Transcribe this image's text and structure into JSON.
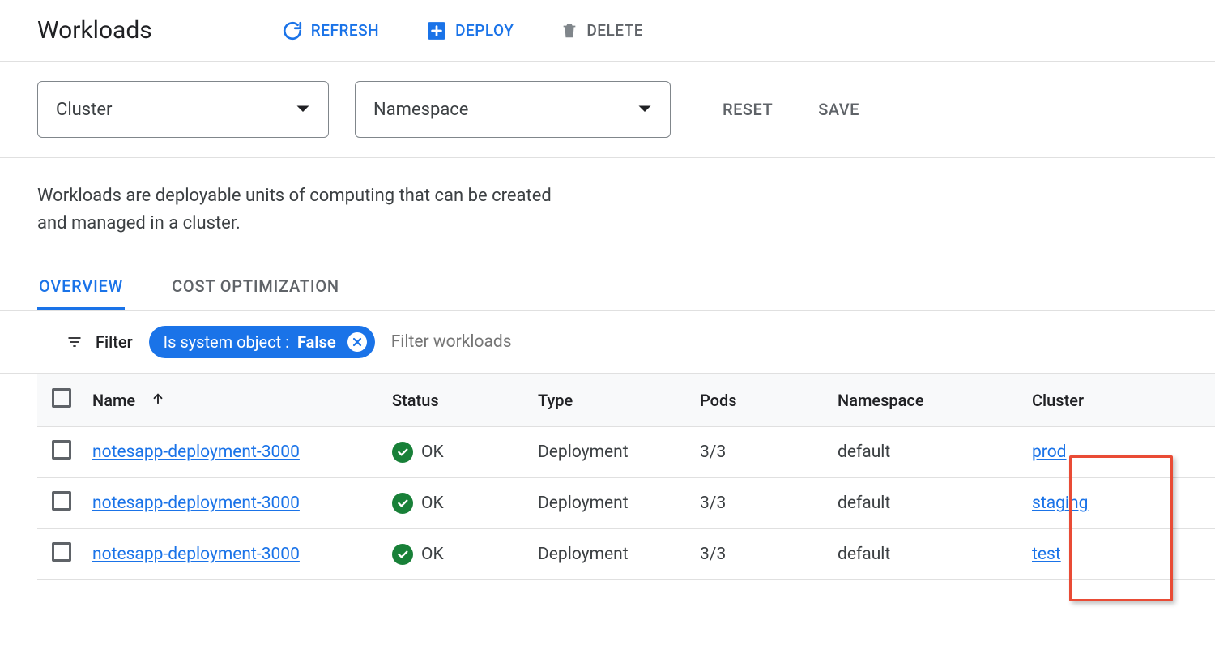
{
  "header": {
    "title": "Workloads",
    "actions": {
      "refresh": "REFRESH",
      "deploy": "DEPLOY",
      "delete": "DELETE"
    }
  },
  "filters": {
    "cluster_label": "Cluster",
    "namespace_label": "Namespace",
    "reset": "RESET",
    "save": "SAVE"
  },
  "description": "Workloads are deployable units of computing that can be created and managed in a cluster.",
  "tabs": {
    "overview": "OVERVIEW",
    "cost_optimization": "COST OPTIMIZATION",
    "active": "overview"
  },
  "filter_bar": {
    "label": "Filter",
    "chip_key": "Is system object :",
    "chip_value": "False",
    "placeholder": "Filter workloads"
  },
  "table": {
    "columns": {
      "name": "Name",
      "status": "Status",
      "type": "Type",
      "pods": "Pods",
      "namespace": "Namespace",
      "cluster": "Cluster"
    },
    "rows": [
      {
        "name": "notesapp-deployment-3000",
        "status": "OK",
        "type": "Deployment",
        "pods": "3/3",
        "namespace": "default",
        "cluster": "prod"
      },
      {
        "name": "notesapp-deployment-3000",
        "status": "OK",
        "type": "Deployment",
        "pods": "3/3",
        "namespace": "default",
        "cluster": "staging"
      },
      {
        "name": "notesapp-deployment-3000",
        "status": "OK",
        "type": "Deployment",
        "pods": "3/3",
        "namespace": "default",
        "cluster": "test"
      }
    ]
  }
}
